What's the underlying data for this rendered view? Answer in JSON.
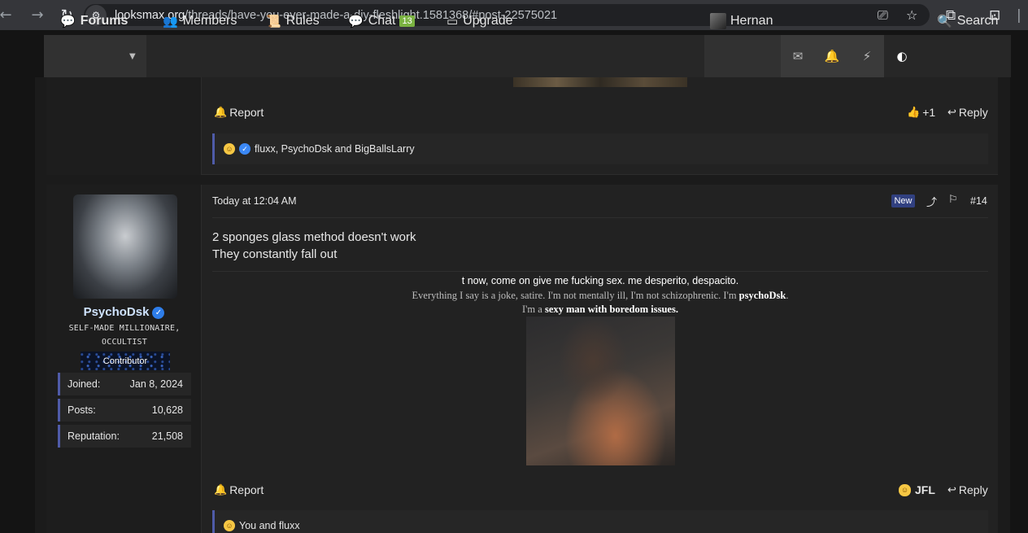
{
  "browser": {
    "url_domain": "looksmax.org",
    "url_path": "/threads/have-you-ever-made-a-diy-fleshlight.1581368/#post-22575021"
  },
  "nav": {
    "forums": "Forums",
    "members": "Members",
    "rules": "Rules",
    "chat": "Chat",
    "chat_count": "13",
    "upgrade": "Upgrade",
    "username": "Hernan",
    "search": "Search"
  },
  "post1": {
    "report": "Report",
    "like_count": "+1",
    "reply": "Reply",
    "reactions_text": "fluxx, PsychoDsk and BigBallsLarry"
  },
  "post2": {
    "author": {
      "name": "PsychoDsk",
      "title": "SELF-MADE MILLIONAIRE, OCCULTIST",
      "banner": "Contributor",
      "stats": [
        {
          "label": "Joined:",
          "value": "Jan 8, 2024"
        },
        {
          "label": "Posts:",
          "value": "10,628"
        },
        {
          "label": "Reputation:",
          "value": "21,508"
        }
      ]
    },
    "date": "Today at 12:04 AM",
    "new_badge": "New",
    "post_number": "#14",
    "body_line1": "2 sponges glass method doesn't work",
    "body_line2": "They constantly fall out",
    "signature": {
      "line1": "t now, come on give me fucking sex. me desperito, despacito.",
      "line2_prefix": "Everything I say is a joke, satire. I'm not mentally ill, I'm not schizophrenic. I'm ",
      "line2_bold": "psychoDsk",
      "line2_suffix": ".",
      "line3_prefix": "I'm a ",
      "line3_bold": "sexy man with boredom issues."
    },
    "report": "Report",
    "reaction_label": "JFL",
    "reply": "Reply",
    "reactions_text": "You and fluxx"
  }
}
